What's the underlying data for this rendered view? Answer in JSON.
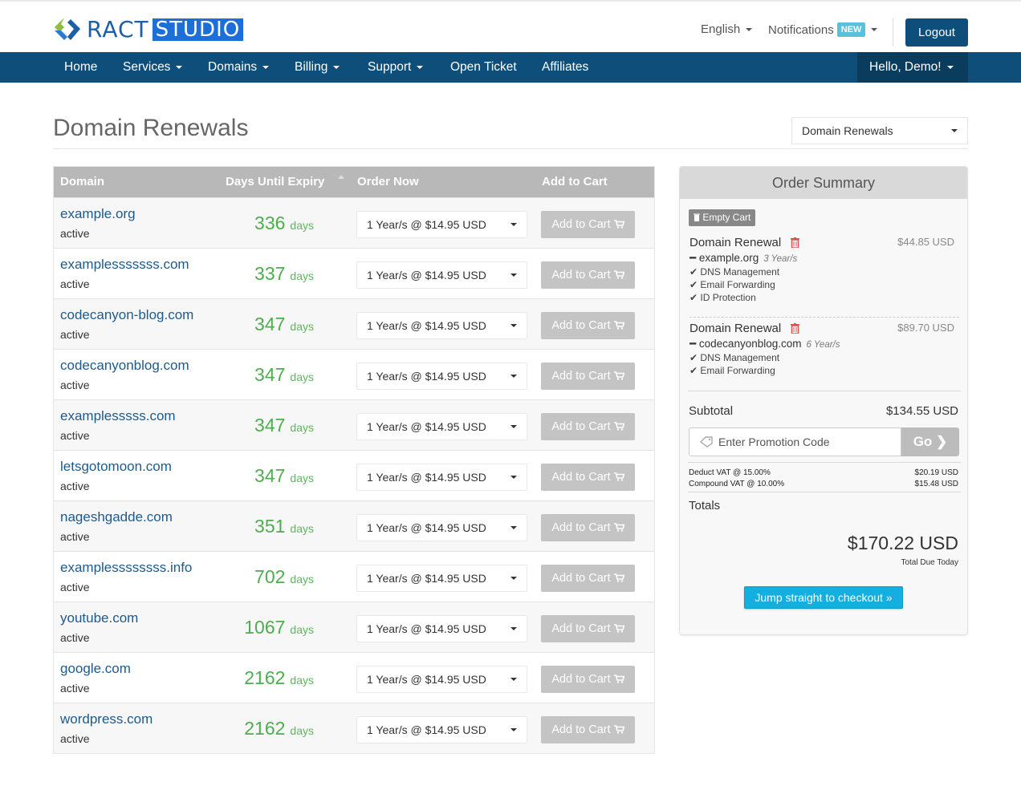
{
  "header": {
    "logo_ract": "RACT",
    "logo_studio": "STUDIO",
    "language": "English",
    "notifications": "Notifications",
    "notifications_badge": "NEW",
    "logout": "Logout"
  },
  "nav": {
    "items": [
      {
        "label": "Home"
      },
      {
        "label": "Services"
      },
      {
        "label": "Domains"
      },
      {
        "label": "Billing"
      },
      {
        "label": "Support"
      },
      {
        "label": "Open Ticket"
      },
      {
        "label": "Affiliates"
      }
    ],
    "user": "Hello, Demo!"
  },
  "page": {
    "title": "Domain Renewals",
    "select_value": "Domain Renewals"
  },
  "table": {
    "headers": {
      "domain": "Domain",
      "days": "Days Until Expiry",
      "order": "Order Now",
      "cart": "Add to Cart"
    },
    "days_unit": "days",
    "rows": [
      {
        "domain": "example.org",
        "status": "active",
        "days": "336",
        "option": "1 Year/s @ $14.95 USD",
        "button": "Add to Cart"
      },
      {
        "domain": "examplesssssss.com",
        "status": "active",
        "days": "337",
        "option": "1 Year/s @ $14.95 USD",
        "button": "Add to Cart"
      },
      {
        "domain": "codecanyon-blog.com",
        "status": "active",
        "days": "347",
        "option": "1 Year/s @ $14.95 USD",
        "button": "Add to Cart"
      },
      {
        "domain": "codecanyonblog.com",
        "status": "active",
        "days": "347",
        "option": "1 Year/s @ $14.95 USD",
        "button": "Add to Cart"
      },
      {
        "domain": "examplesssss.com",
        "status": "active",
        "days": "347",
        "option": "1 Year/s @ $14.95 USD",
        "button": "Add to Cart"
      },
      {
        "domain": "letsgotomoon.com",
        "status": "active",
        "days": "347",
        "option": "1 Year/s @ $14.95 USD",
        "button": "Add to Cart"
      },
      {
        "domain": "nageshgadde.com",
        "status": "active",
        "days": "351",
        "option": "1 Year/s @ $14.95 USD",
        "button": "Add to Cart"
      },
      {
        "domain": "examplessssssss.info",
        "status": "active",
        "days": "702",
        "option": "1 Year/s @ $14.95 USD",
        "button": "Add to Cart"
      },
      {
        "domain": "youtube.com",
        "status": "active",
        "days": "1067",
        "option": "1 Year/s @ $14.95 USD",
        "button": "Add to Cart"
      },
      {
        "domain": "google.com",
        "status": "active",
        "days": "2162",
        "option": "1 Year/s @ $14.95 USD",
        "button": "Add to Cart"
      },
      {
        "domain": "wordpress.com",
        "status": "active",
        "days": "2162",
        "option": "1 Year/s @ $14.95 USD",
        "button": "Add to Cart"
      }
    ]
  },
  "summary": {
    "title": "Order Summary",
    "empty_cart": "Empty Cart",
    "items": [
      {
        "title": "Domain Renewal",
        "price": "$44.85 USD",
        "domain": "example.org",
        "years": "3 Year/s",
        "addons": [
          "DNS Management",
          "Email Forwarding",
          "ID Protection"
        ]
      },
      {
        "title": "Domain Renewal",
        "price": "$89.70 USD",
        "domain": "codecanyonblog.com",
        "years": "6 Year/s",
        "addons": [
          "DNS Management",
          "Email Forwarding"
        ]
      }
    ],
    "subtotal_label": "Subtotal",
    "subtotal": "$134.55 USD",
    "promo_placeholder": "Enter Promotion Code",
    "go": "Go",
    "taxes": [
      {
        "label": "Deduct VAT @ 15.00%",
        "value": "$20.19 USD"
      },
      {
        "label": "Compound VAT @ 10.00%",
        "value": "$15.48 USD"
      }
    ],
    "totals_label": "Totals",
    "total": "$170.22 USD",
    "total_sub": "Total Due Today",
    "checkout": "Jump straight to checkout »"
  },
  "colors": {
    "brand": "#0e4e7a",
    "days_green": "#4cae4c",
    "checkout_blue": "#14aee0"
  }
}
